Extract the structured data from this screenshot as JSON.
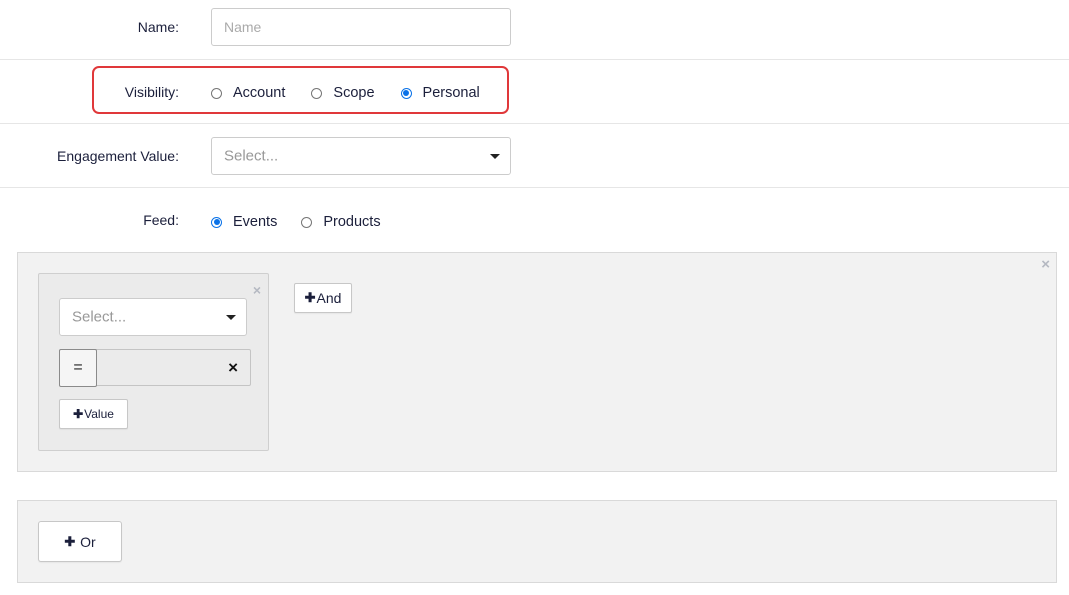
{
  "form": {
    "name": {
      "label": "Name:",
      "placeholder": "Name",
      "value": ""
    },
    "visibility": {
      "label": "Visibility:",
      "options": [
        {
          "label": "Account",
          "checked": false
        },
        {
          "label": "Scope",
          "checked": false
        },
        {
          "label": "Personal",
          "checked": true
        }
      ],
      "highlight_color": "#e0383a"
    },
    "engagement": {
      "label": "Engagement Value:",
      "placeholder": "Select..."
    },
    "feed": {
      "label": "Feed:",
      "options": [
        {
          "label": "Events",
          "checked": true
        },
        {
          "label": "Products",
          "checked": false
        }
      ]
    }
  },
  "condition_group": {
    "close_icon": "×",
    "condition": {
      "close_icon": "×",
      "field_placeholder": "Select...",
      "operator": "=",
      "clear_icon": "×",
      "add_value_plus": "✚",
      "add_value_label": "Value"
    },
    "and_plus": "✚",
    "and_label": "And"
  },
  "or_group": {
    "or_plus": "✚",
    "or_label": " Or"
  },
  "colors": {
    "accent": "#0a72e8",
    "panel_bg": "#f2f2f2"
  }
}
